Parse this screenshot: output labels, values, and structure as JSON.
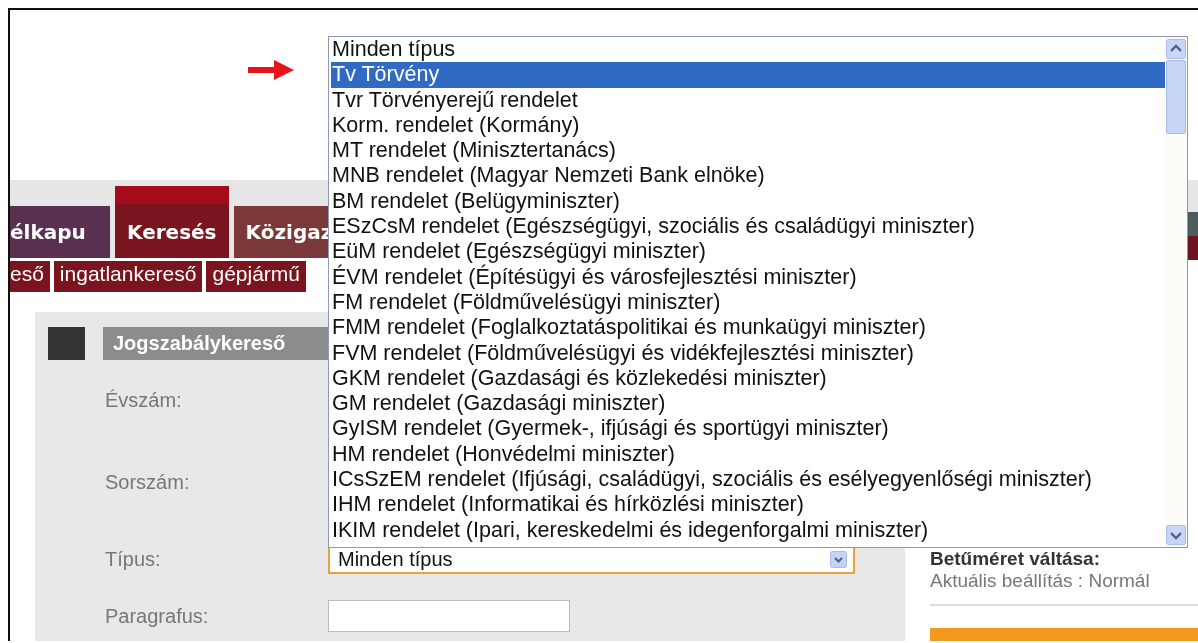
{
  "nav_tabs": [
    {
      "label": "élkapu",
      "selected": false,
      "color": "#5a3050"
    },
    {
      "label": "Keresés",
      "selected": true,
      "color": "#7a1520"
    },
    {
      "label": "Közigaz",
      "selected": false,
      "color": "#7a3838"
    }
  ],
  "sub_tabs": [
    {
      "label": "eső"
    },
    {
      "label": "ingatlankereső"
    },
    {
      "label": "gépjármű"
    }
  ],
  "search_panel": {
    "title": "Jogszabálykereső",
    "fields": [
      {
        "label": "Évszám:",
        "kind": "hidden"
      },
      {
        "label": "Sorszám:",
        "kind": "hidden"
      },
      {
        "label": "Típus:",
        "kind": "select",
        "value": "Minden típus"
      },
      {
        "label": "Paragrafus:",
        "kind": "text"
      }
    ]
  },
  "dropdown_options": [
    {
      "label": "Minden típus",
      "selected": false
    },
    {
      "label": "Tv Törvény",
      "selected": true
    },
    {
      "label": "Tvr Törvényerejű rendelet",
      "selected": false
    },
    {
      "label": "Korm. rendelet (Kormány)",
      "selected": false
    },
    {
      "label": "MT rendelet (Minisztertanács)",
      "selected": false
    },
    {
      "label": "MNB rendelet (Magyar Nemzeti Bank elnöke)",
      "selected": false
    },
    {
      "label": "BM rendelet (Belügyminiszter)",
      "selected": false
    },
    {
      "label": "ESzCsM rendelet (Egészségügyi, szociális és családügyi miniszter)",
      "selected": false
    },
    {
      "label": "EüM rendelet (Egészségügyi miniszter)",
      "selected": false
    },
    {
      "label": "ÉVM rendelet (Építésügyi és városfejlesztési miniszter)",
      "selected": false
    },
    {
      "label": "FM rendelet (Földművelésügyi miniszter)",
      "selected": false
    },
    {
      "label": "FMM rendelet (Foglalkoztatáspolitikai és munkaügyi miniszter)",
      "selected": false
    },
    {
      "label": "FVM rendelet (Földművelésügyi és vidékfejlesztési miniszter)",
      "selected": false
    },
    {
      "label": "GKM rendelet (Gazdasági és közlekedési miniszter)",
      "selected": false
    },
    {
      "label": "GM rendelet (Gazdasági miniszter)",
      "selected": false
    },
    {
      "label": "GyISM rendelet (Gyermek-, ifjúsági és sportügyi miniszter)",
      "selected": false
    },
    {
      "label": "HM rendelet (Honvédelmi miniszter)",
      "selected": false
    },
    {
      "label": "ICsSzEM rendelet (Ifjúsági, családügyi, szociális és esélyegyenlőségi miniszter)",
      "selected": false
    },
    {
      "label": "IHM rendelet (Informatikai és hírközlési miniszter)",
      "selected": false
    },
    {
      "label": "IKIM rendelet (Ipari, kereskedelmi és idegenforgalmi miniszter)",
      "selected": false
    }
  ],
  "font_size_box": {
    "title": "Betűméret váltása:",
    "setting": "Aktuális beállítás : Normál"
  }
}
